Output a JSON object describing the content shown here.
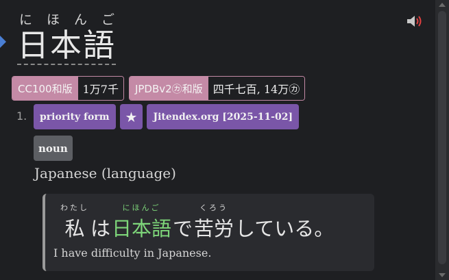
{
  "headword": {
    "reading_chars": [
      "に",
      "ほ",
      "ん",
      "ご"
    ],
    "term": "日本語"
  },
  "frequencies": [
    {
      "label": "CC100和版",
      "value": "1万7千"
    },
    {
      "label": "JPDBv2㋕和版",
      "value": "四千七百, 14万㋕"
    }
  ],
  "sense": {
    "number": "1.",
    "tags": [
      "priority form",
      "★",
      "Jitendex.org [2025-11-02]"
    ],
    "part_of_speech": "noun",
    "gloss": "Japanese (language)"
  },
  "example": {
    "segments": [
      {
        "base": "私",
        "ruby": "わたし",
        "highlight": false
      },
      {
        "base": "は",
        "ruby": "",
        "highlight": false
      },
      {
        "base": "日本語",
        "ruby": "にほんご",
        "highlight": true
      },
      {
        "base": "で",
        "ruby": "",
        "highlight": false
      },
      {
        "base": "苦労",
        "ruby": "くろう",
        "highlight": false
      },
      {
        "base": "している。",
        "ruby": "",
        "highlight": false
      }
    ],
    "translation": "I have difficulty in Japanese."
  },
  "colors": {
    "background": "#1e1f22",
    "frequency_tag": "#c48aa6",
    "dictionary_tag": "#7a56a8",
    "pos_tag": "#5c5e63",
    "highlight": "#7ed67a",
    "headword_marker": "#4a7fd4"
  },
  "icons": {
    "audio": "speaker-icon"
  }
}
